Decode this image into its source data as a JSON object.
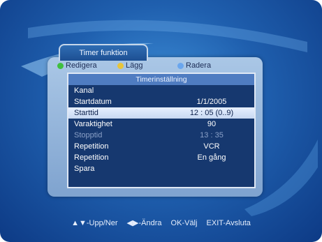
{
  "tab": {
    "title": "Timer funktion"
  },
  "toolbar": {
    "items": [
      {
        "label": "Redigera",
        "color": "#3fbf3f",
        "icon": "green-button-icon"
      },
      {
        "label": "Lägg",
        "color": "#e8c53a",
        "icon": "yellow-button-icon"
      },
      {
        "label": "Radera",
        "color": "#6aa6ee",
        "icon": "blue-button-icon"
      }
    ]
  },
  "dialog": {
    "title": "Timerinställning",
    "rows": [
      {
        "label": "Kanal",
        "value": ""
      },
      {
        "label": "Startdatum",
        "value": "1/1/2005"
      },
      {
        "label": "Starttid",
        "value": "12 : 05 (0..9)"
      },
      {
        "label": "Varaktighet",
        "value": "90"
      },
      {
        "label": "Stopptid",
        "value": "13 : 35"
      },
      {
        "label": "Repetition",
        "value": "VCR"
      },
      {
        "label": "Repetition",
        "value": "En gång"
      },
      {
        "label": "Spara",
        "value": ""
      }
    ]
  },
  "footer": {
    "up_down": "▲▼-Upp/Ner",
    "change": "◀▶-Ändra",
    "ok": "OK-Välj",
    "exit": "EXIT-Avsluta"
  }
}
